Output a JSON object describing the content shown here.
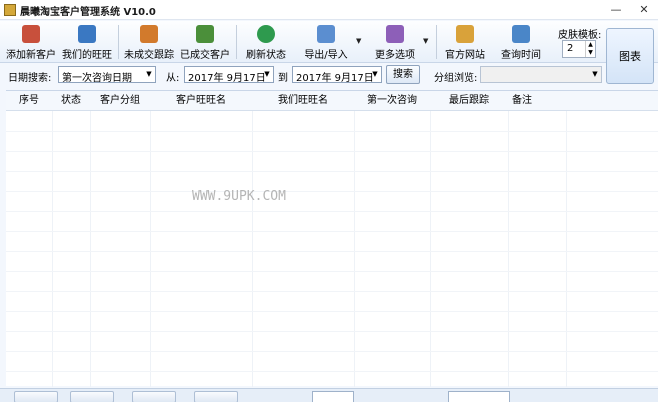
{
  "window": {
    "title": "晨曦淘宝客户管理系统 V10.0",
    "minimize_glyph": "—",
    "close_glyph": "✕"
  },
  "toolbar": {
    "buttons": [
      {
        "label": "添加新客户",
        "icon": "add-customer-icon",
        "color": "#c8503c"
      },
      {
        "label": "我们的旺旺",
        "icon": "user-icon",
        "color": "#3a78c2"
      },
      {
        "label": "未成交跟踪",
        "icon": "pending-deal-icon",
        "color": "#d27a2c"
      },
      {
        "label": "已成交客户",
        "icon": "closed-deal-icon",
        "color": "#4b8f3a"
      },
      {
        "label": "刷新状态",
        "icon": "refresh-icon",
        "color": "#2e9a4e"
      },
      {
        "label": "导出/导入",
        "icon": "import-export-icon",
        "color": "#5b8ed0"
      },
      {
        "label": "更多选项",
        "icon": "more-options-icon",
        "color": "#8d5fb8"
      },
      {
        "label": "官方网站",
        "icon": "website-icon",
        "color": "#d9a23a"
      },
      {
        "label": "查询时间",
        "icon": "query-time-icon",
        "color": "#4a86c8"
      }
    ],
    "dropdown_arrow": "▼",
    "skin_label": "皮肤模板:",
    "skin_value": "2",
    "chart_label": "图表"
  },
  "filter": {
    "date_search_label": "日期搜索:",
    "date_type_value": "第一次咨询日期",
    "from_label": "从:",
    "from_date": "2017年 9月17日",
    "to_label": "到",
    "to_date": "2017年 9月17日",
    "search_label": "搜索",
    "group_browse_label": "分组浏览:",
    "group_value": ""
  },
  "table": {
    "columns": [
      "序号",
      "状态",
      "客户分组",
      "客户旺旺名",
      "我们旺旺名",
      "第一次咨询",
      "最后跟踪",
      "备注"
    ],
    "rows": []
  },
  "watermark": "WWW.9UPK.COM",
  "colors": {
    "accent": "#3a78c2",
    "window_bg": "#f3f7fd"
  }
}
